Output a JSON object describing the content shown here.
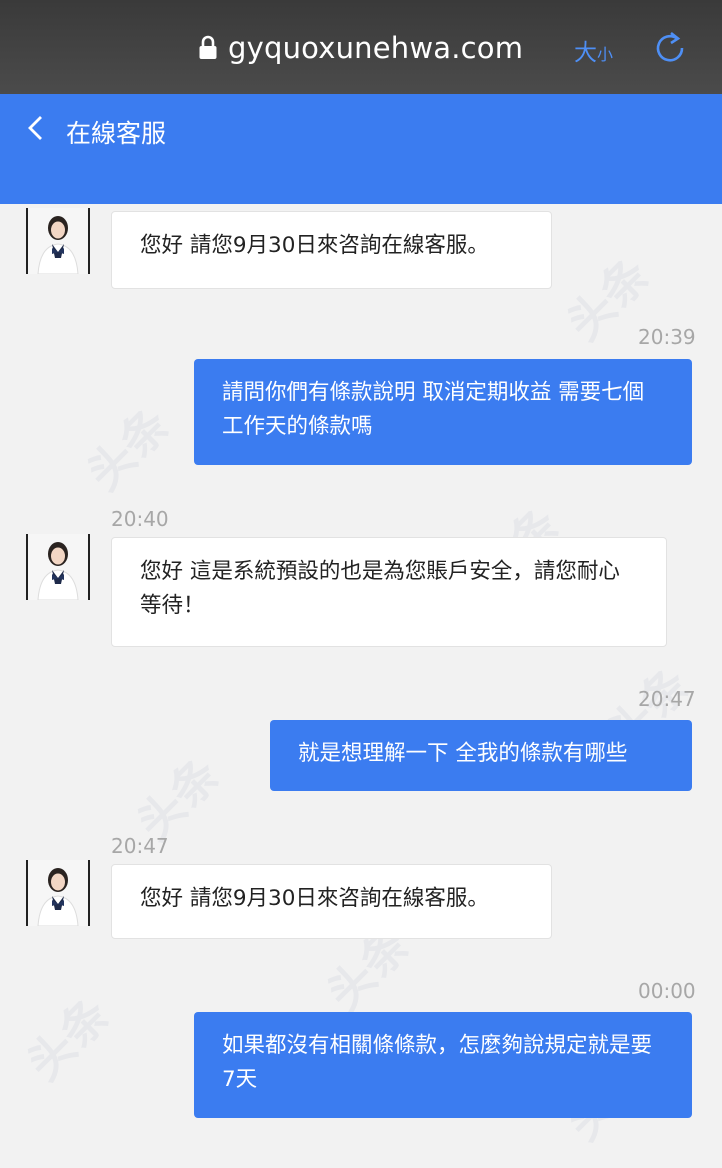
{
  "browser": {
    "url": "gyquoxunehwa.com",
    "font_size_label_big": "大",
    "font_size_label_small": "小"
  },
  "header": {
    "title": "在線客服"
  },
  "messages": [
    {
      "role": "agent",
      "text": "您好 請您9月30日來咨詢在線客服。"
    },
    {
      "role": "user",
      "time": "20:39",
      "text": "請問你們有條款說明 取消定期收益 需要七個工作天的條款嗎"
    },
    {
      "role": "agent",
      "time": "20:40",
      "text": "您好 這是系統預設的也是為您賬戶安全，請您耐心等待！"
    },
    {
      "role": "user",
      "time": "20:47",
      "text": "就是想理解一下 全我的條款有哪些"
    },
    {
      "role": "agent",
      "time": "20:47",
      "text": "您好 請您9月30日來咨詢在線客服。"
    },
    {
      "role": "user",
      "time": "00:00",
      "text": "如果都沒有相關條條款，怎麼夠說規定就是要7天"
    }
  ],
  "colors": {
    "accent": "#3b7cf0",
    "browser_bar": "#444444",
    "background": "#f2f2f2"
  },
  "icons": [
    "lock-icon",
    "reload-icon",
    "back-icon",
    "avatar"
  ]
}
